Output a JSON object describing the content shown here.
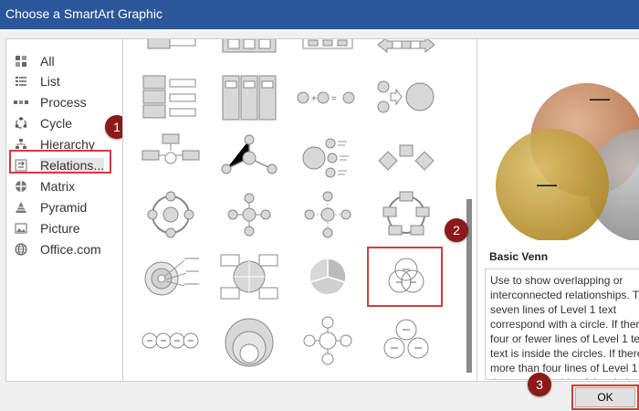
{
  "window": {
    "title": "Choose a SmartArt Graphic"
  },
  "categories": [
    {
      "label": "All",
      "icon": "grid-icon"
    },
    {
      "label": "List",
      "icon": "list-icon"
    },
    {
      "label": "Process",
      "icon": "process-icon"
    },
    {
      "label": "Cycle",
      "icon": "cycle-icon"
    },
    {
      "label": "Hierarchy",
      "icon": "hierarchy-icon"
    },
    {
      "label": "Relations...",
      "icon": "relationship-icon",
      "selected": true
    },
    {
      "label": "Matrix",
      "icon": "matrix-icon"
    },
    {
      "label": "Pyramid",
      "icon": "pyramid-icon"
    },
    {
      "label": "Picture",
      "icon": "picture-icon"
    },
    {
      "label": "Office.com",
      "icon": "globe-icon"
    }
  ],
  "callouts": {
    "one": "1",
    "two": "2",
    "three": "3"
  },
  "preview": {
    "name": "Basic Venn",
    "description": "Use to show overlapping or interconnected relationships. The first seven lines of Level 1 text correspond with a circle. If there are four or fewer lines of Level 1 text, the text is inside the circles. If there are more than four lines of Level 1 text, the text is outside of the circles.",
    "dash": "—"
  },
  "buttons": {
    "ok": "OK"
  },
  "colors": {
    "titlebar": "#2b579a",
    "highlight": "#d23b3b",
    "callout": "#8b1a1a",
    "venn_orange": "#c98a5e",
    "venn_gold": "#c9a33f",
    "venn_gray": "#9a9a9a"
  }
}
